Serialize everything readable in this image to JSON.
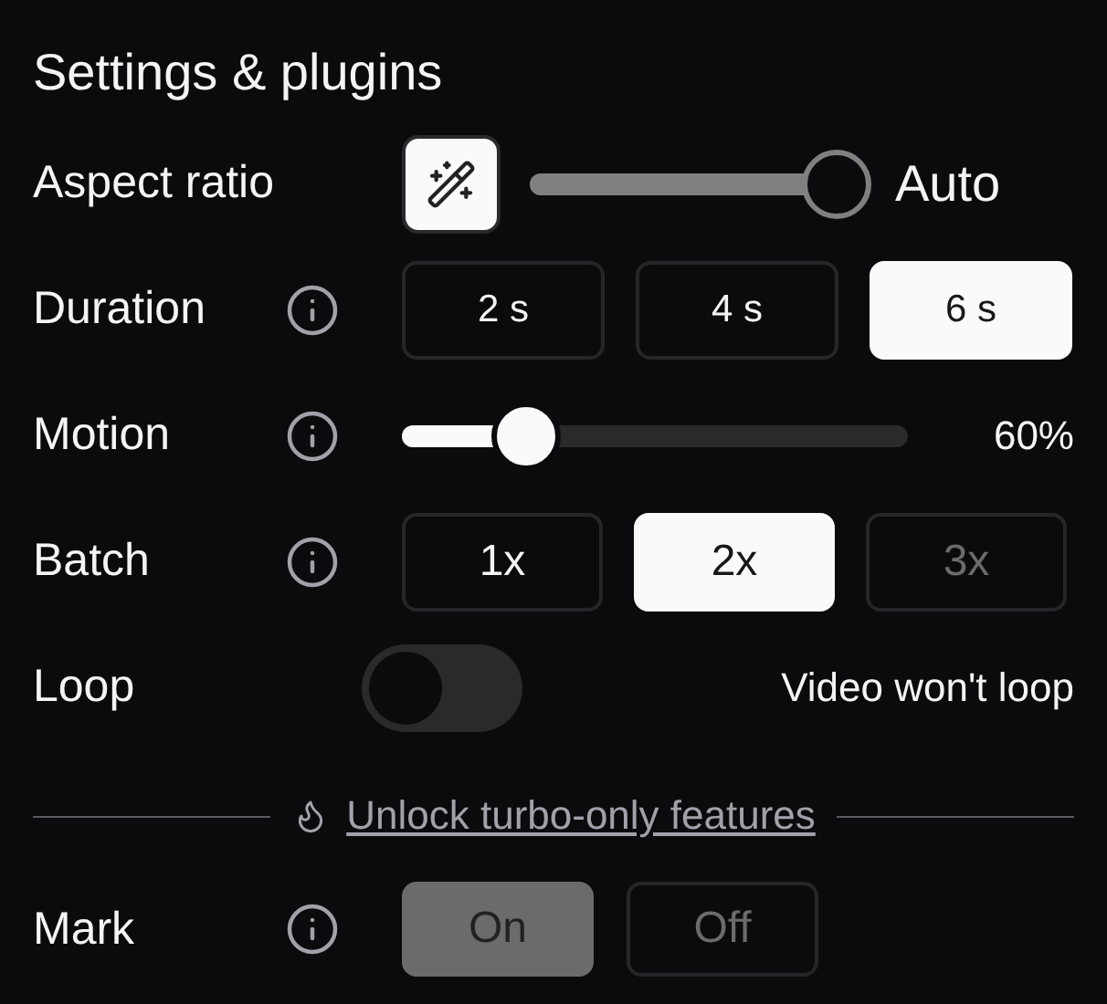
{
  "title": "Settings & plugins",
  "aspect_ratio": {
    "label": "Aspect ratio",
    "auto": true,
    "level": 1,
    "value": "Auto"
  },
  "duration": {
    "label": "Duration",
    "info": true,
    "options": [
      {
        "label": "2 s",
        "selected": false
      },
      {
        "label": "4 s",
        "selected": false
      },
      {
        "label": "6 s",
        "selected": true
      }
    ]
  },
  "motion": {
    "label": "Motion",
    "info": true,
    "level": 0.245,
    "reading": "60%"
  },
  "batch": {
    "label": "Batch",
    "info": true,
    "options": [
      {
        "label": "1x",
        "selected": false,
        "disabled": false
      },
      {
        "label": "2x",
        "selected": true,
        "disabled": false
      },
      {
        "label": "3x",
        "selected": false,
        "disabled": true
      }
    ]
  },
  "loop": {
    "label": "Loop",
    "on": false,
    "status": "Video won't loop"
  },
  "turbo_link": "Unlock turbo-only features",
  "mark": {
    "label": "Mark",
    "info": true,
    "disabled": true,
    "options": [
      {
        "label": "On",
        "selected": true
      },
      {
        "label": "Off",
        "selected": false
      }
    ]
  }
}
